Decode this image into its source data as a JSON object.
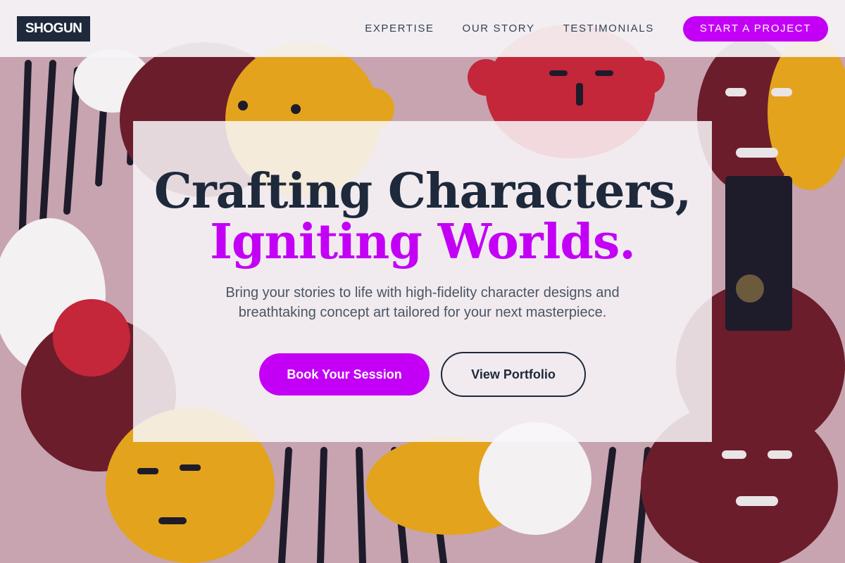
{
  "brand": {
    "logo_text": "SHOGUN"
  },
  "nav": {
    "links": [
      "EXPERTISE",
      "OUR STORY",
      "TESTIMONIALS"
    ],
    "cta_label": "START A PROJECT"
  },
  "hero": {
    "headline_line1": "Crafting Characters,",
    "headline_line2": "Igniting Worlds.",
    "subtitle": "Bring your stories to life with high-fidelity character designs and breathtaking concept art tailored for your next masterpiece.",
    "primary_button": "Book Your Session",
    "secondary_button": "View Portfolio"
  },
  "colors": {
    "accent": "#c300f5",
    "dark": "#1e293b",
    "body_text": "#4b5563",
    "background_mural": "#c9a6b3"
  }
}
